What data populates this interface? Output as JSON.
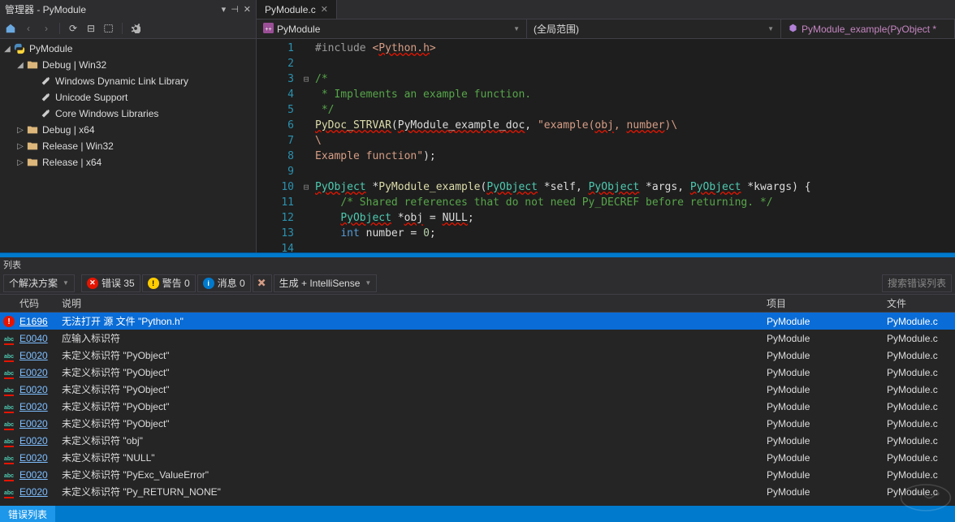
{
  "left_panel": {
    "title": "管理器 - PyModule",
    "toolbar_icons": [
      "home",
      "back",
      "forward",
      "refresh",
      "collapse",
      "show-all",
      "properties"
    ]
  },
  "tree": {
    "root": "PyModule",
    "config_debug_win32": "Debug | Win32",
    "ref_wdk": "Windows Dynamic Link Library",
    "ref_unicode": "Unicode Support",
    "ref_corewin": "Core Windows Libraries",
    "debug_x64": "Debug | x64",
    "rel_win32": "Release | Win32",
    "rel_x64": "Release | x64"
  },
  "tabs": {
    "active": "PyModule.c"
  },
  "navbar": {
    "project": "PyModule",
    "scope": "(全局范围)",
    "member": "PyModule_example(PyObject *"
  },
  "code_lines": [
    {
      "n": 1,
      "fold": "",
      "html": "<span class=\"c-pp\">#include</span> <span class=\"c-str\">&lt;<span class=\"c-err\">Python.h</span>&gt;</span>"
    },
    {
      "n": 2,
      "fold": "",
      "html": ""
    },
    {
      "n": 3,
      "fold": "⊟",
      "html": "<span class=\"c-cmt\">/*</span>"
    },
    {
      "n": 4,
      "fold": "",
      "html": "<span class=\"c-cmt\"> * Implements an example function.</span>"
    },
    {
      "n": 5,
      "fold": "",
      "html": "<span class=\"c-cmt\"> */</span>"
    },
    {
      "n": 6,
      "fold": "",
      "html": "<span class=\"c-fn c-err\">PyDoc_STRVAR</span>(<span class=\"c-err\">PyModule_example_doc</span>, <span class=\"c-str\">\"example(<span class=\"c-err\">obj</span>, <span class=\"c-err\">number</span>)\\</span>"
    },
    {
      "n": 7,
      "fold": "",
      "html": "<span class=\"c-str\">\\</span>"
    },
    {
      "n": 8,
      "fold": "",
      "html": "<span class=\"c-str\">Example function\"</span>);"
    },
    {
      "n": 9,
      "fold": "",
      "html": ""
    },
    {
      "n": 10,
      "fold": "⊟",
      "html": "<span class=\"c-typ c-err\">PyObject</span> *<span class=\"c-fn\">PyModule_example</span>(<span class=\"c-typ c-err\">PyObject</span> *<span class=\"c-id\">self</span>, <span class=\"c-typ c-err\">PyObject</span> *<span class=\"c-id\">args</span>, <span class=\"c-typ c-err\">PyObject</span> *<span class=\"c-id\">kwargs</span>) {"
    },
    {
      "n": 11,
      "fold": "",
      "html": "    <span class=\"c-cmt\">/* Shared references that do not need Py_DECREF before returning. */</span>"
    },
    {
      "n": 12,
      "fold": "",
      "html": "    <span class=\"c-typ c-err\">PyObject</span> *<span class=\"c-err\">obj</span> = <span class=\"c-err\">NULL</span>;"
    },
    {
      "n": 13,
      "fold": "",
      "html": "    <span class=\"c-kw\">int</span> <span class=\"c-id\">number</span> = <span class=\"c-num\">0</span>;"
    },
    {
      "n": 14,
      "fold": "",
      "html": ""
    }
  ],
  "error_panel": {
    "header": "列表",
    "solution_scope": "个解决方案",
    "errors_label": "错误 35",
    "warnings_label": "警告 0",
    "messages_label": "消息 0",
    "build_intellisense": "生成 + IntelliSense",
    "search_placeholder": "搜索错误列表",
    "bottom_tab": "错误列表"
  },
  "error_columns": {
    "code": "代码",
    "desc": "说明",
    "proj": "项目",
    "file": "文件"
  },
  "errors": [
    {
      "icon": "crit",
      "code": "E1696",
      "desc": "无法打开 源 文件 \"Python.h\"",
      "proj": "PyModule",
      "file": "PyModule.c",
      "selected": true
    },
    {
      "icon": "abc",
      "code": "E0040",
      "desc": "应输入标识符",
      "proj": "PyModule",
      "file": "PyModule.c"
    },
    {
      "icon": "abc",
      "code": "E0020",
      "desc": "未定义标识符 \"PyObject\"",
      "proj": "PyModule",
      "file": "PyModule.c"
    },
    {
      "icon": "abc",
      "code": "E0020",
      "desc": "未定义标识符 \"PyObject\"",
      "proj": "PyModule",
      "file": "PyModule.c"
    },
    {
      "icon": "abc",
      "code": "E0020",
      "desc": "未定义标识符 \"PyObject\"",
      "proj": "PyModule",
      "file": "PyModule.c"
    },
    {
      "icon": "abc",
      "code": "E0020",
      "desc": "未定义标识符 \"PyObject\"",
      "proj": "PyModule",
      "file": "PyModule.c"
    },
    {
      "icon": "abc",
      "code": "E0020",
      "desc": "未定义标识符 \"PyObject\"",
      "proj": "PyModule",
      "file": "PyModule.c"
    },
    {
      "icon": "abc",
      "code": "E0020",
      "desc": "未定义标识符 \"obj\"",
      "proj": "PyModule",
      "file": "PyModule.c"
    },
    {
      "icon": "abc",
      "code": "E0020",
      "desc": "未定义标识符 \"NULL\"",
      "proj": "PyModule",
      "file": "PyModule.c"
    },
    {
      "icon": "abc",
      "code": "E0020",
      "desc": "未定义标识符 \"PyExc_ValueError\"",
      "proj": "PyModule",
      "file": "PyModule.c"
    },
    {
      "icon": "abc",
      "code": "E0020",
      "desc": "未定义标识符 \"Py_RETURN_NONE\"",
      "proj": "PyModule",
      "file": "PyModule.c"
    }
  ]
}
